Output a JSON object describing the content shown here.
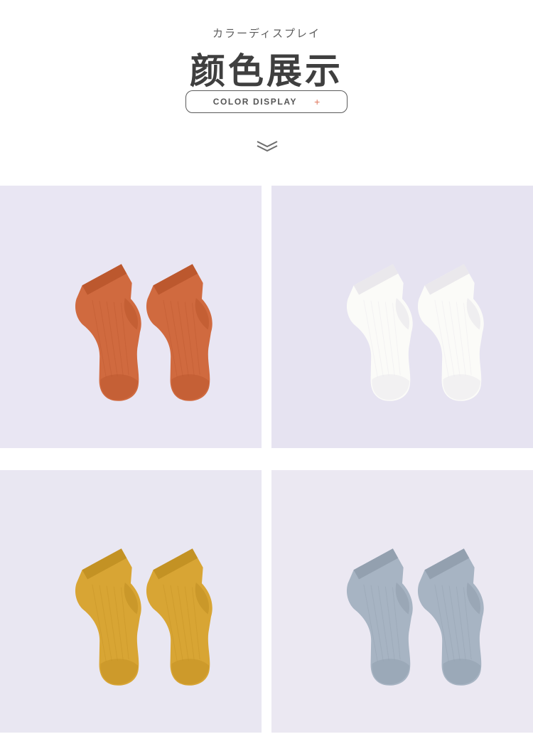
{
  "header": {
    "subtitle_jp": "カラーディスプレイ",
    "title_cn": "颜色展示",
    "pill_label": "COLOR DISPLAY",
    "pill_symbol": "+",
    "pill_symbol_color": "#e07a5f",
    "scroll_icon": "double-chevron-down-icon"
  },
  "photos": [
    {
      "name": "orange-socks",
      "sock_color": "#d06a3f",
      "shade_color": "#b9552c",
      "bg": "#e9e6f3"
    },
    {
      "name": "white-socks",
      "sock_color": "#fbfbf8",
      "shade_color": "#e6e4ea",
      "bg": "#e6e3f1"
    },
    {
      "name": "mustard-socks",
      "sock_color": "#d8a534",
      "shade_color": "#c08e22",
      "bg": "#e9e7f2"
    },
    {
      "name": "gray-blue-socks",
      "sock_color": "#a7b4c3",
      "shade_color": "#8f9cab",
      "bg": "#ebe8f2"
    }
  ]
}
